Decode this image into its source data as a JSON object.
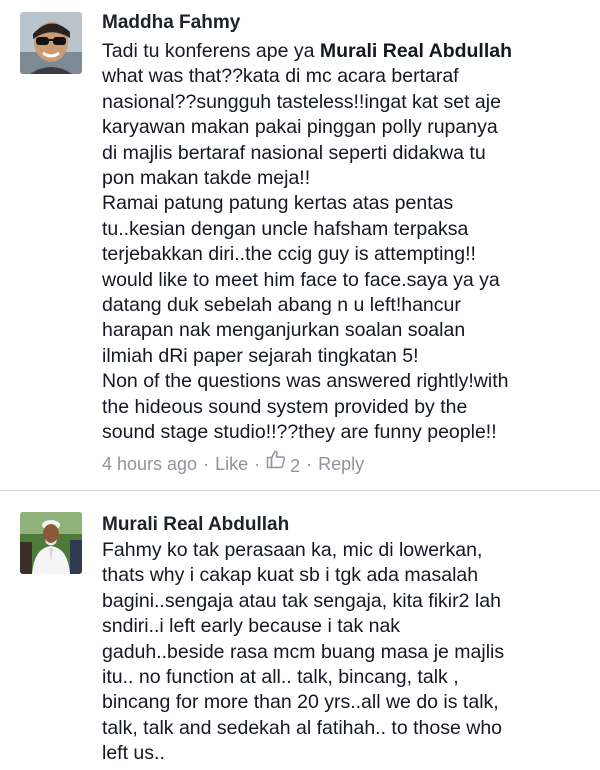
{
  "comments": [
    {
      "author": "Maddha Fahmy",
      "text_before_mention": "Tadi tu konferens ape ya ",
      "mention": "Murali Real Abdullah",
      "text_after_mention": "\nwhat was that??kata di mc acara bertaraf\nnasional??sungguh tasteless!!ingat kat set aje\nkaryawan makan pakai pinggan polly rupanya\ndi majlis bertaraf nasional seperti didakwa tu\npon makan takde meja!!\nRamai patung patung kertas atas pentas\ntu..kesian dengan uncle hafsham terpaksa\nterjebakkan diri..the ccig guy is attempting!!\nwould like to meet him face to face.saya ya ya\ndatang duk sebelah abang n u left!hancur\nharapan nak menganjurkan soalan soalan\nilmiah dRi paper sejarah tingkatan 5!\nNon of the questions was answered rightly!with\nthe hideous sound system provided by the\nsound stage studio!!??they are funny people!!",
      "time": "4 hours ago",
      "like_label": "Like",
      "like_count": "2",
      "reply_label": "Reply",
      "separator": "·"
    },
    {
      "author": "Murali Real Abdullah",
      "text": "Fahmy ko tak perasaan ka, mic di lowerkan,\nthats why i cakap kuat sb i tgk ada masalah\nbagini..sengaja atau tak sengaja, kita fikir2 lah\nsndiri..i left early because i tak nak\ngaduh..beside rasa mcm buang masa je majlis\nitu.. no function at all.. talk, bincang, talk ,\nbincang for more than 20 yrs..all we do is talk,\ntalk, talk and sedekah al fatihah.. to those who\nleft us.."
    }
  ],
  "colors": {
    "author": "#1d2129",
    "body_text": "#141823",
    "meta_text": "#90949c",
    "divider": "#d3d6db"
  },
  "icons": [
    "thumbs-up-icon"
  ]
}
